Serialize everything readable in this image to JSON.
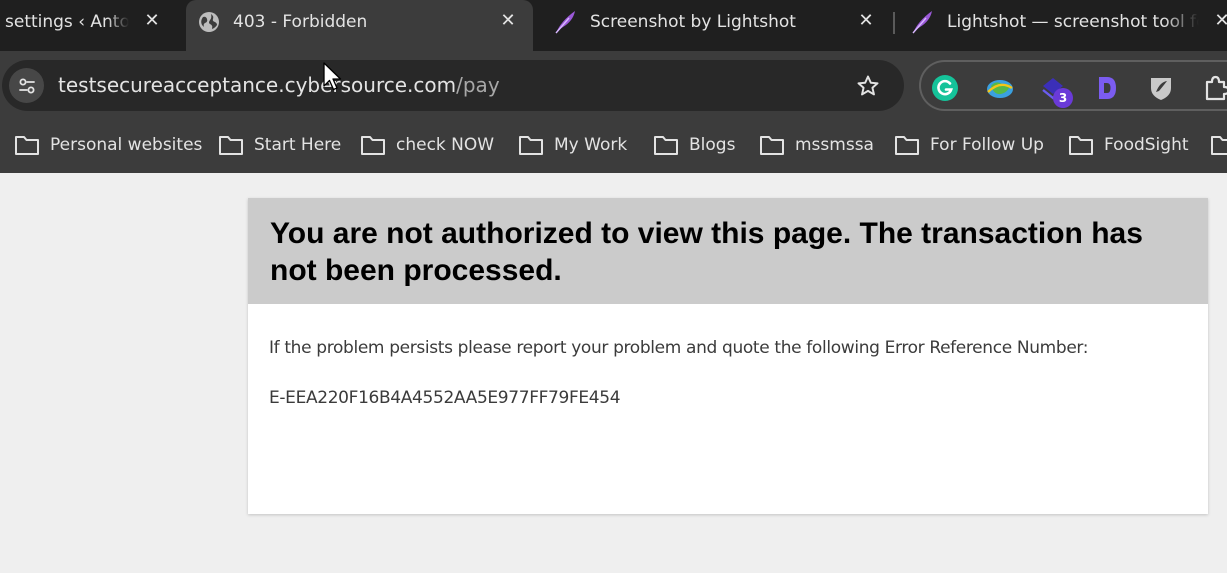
{
  "tabs": [
    {
      "title": "settings ‹ Antoi",
      "close": "✕",
      "active": false
    },
    {
      "title": "403 - Forbidden",
      "close": "✕",
      "active": true
    },
    {
      "title": "Screenshot by Lightshot",
      "close": "✕",
      "active": false
    },
    {
      "title": "Lightshot — screenshot tool for",
      "close": "✕",
      "active": false
    }
  ],
  "omnibox": {
    "host": "testsecureacceptance.cybersource.com",
    "path": "/pay"
  },
  "extensions": {
    "badge_count": "3"
  },
  "bookmarks": [
    "Personal websites",
    "Start Here",
    "check NOW",
    "My Work",
    "Blogs",
    "mssmssa",
    "For Follow Up",
    "FoodSight"
  ],
  "page": {
    "title": "You are not authorized to view this page. The transaction has not been processed.",
    "message": "If the problem persists please report your problem and quote the following Error Reference Number:",
    "reference": "E-EEA220F16B4A4552AA5E977FF79FE454"
  },
  "colors": {
    "tabstrip_bg": "#1f1f1f",
    "toolbar_bg": "#3c3c3c",
    "omnibox_bg": "#282828",
    "page_bg": "#efefef",
    "error_header_bg": "#cbcbcb",
    "lightshot_accent": "#9b59d8",
    "badge_bg": "#6a3ad8"
  }
}
